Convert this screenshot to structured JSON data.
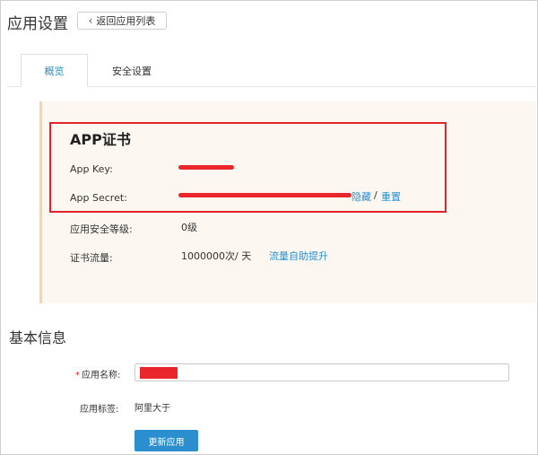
{
  "header": {
    "title": "应用设置",
    "back_button": "返回应用列表"
  },
  "tabs": [
    {
      "label": "概览",
      "active": true
    },
    {
      "label": "安全设置",
      "active": false
    }
  ],
  "certificate": {
    "title": "APP证书",
    "app_key_label": "App Key:",
    "app_secret_label": "App Secret:",
    "hide_link": "隐藏",
    "separator": "/",
    "reset_link": "重置"
  },
  "security": {
    "level_label": "应用安全等级:",
    "level_value": "0级",
    "traffic_label": "证书流量:",
    "traffic_value": "1000000次/ 天",
    "traffic_link": "流量自助提升"
  },
  "basic_info": {
    "title": "基本信息",
    "required_mark": "*",
    "name_label": "应用名称:",
    "tag_label": "应用标签:",
    "tag_value": "阿里大于",
    "submit_button": "更新应用"
  },
  "colors": {
    "accent": "#2a8ecf",
    "highlight_border": "#e2232a",
    "panel_bg": "#fcf8f1"
  }
}
